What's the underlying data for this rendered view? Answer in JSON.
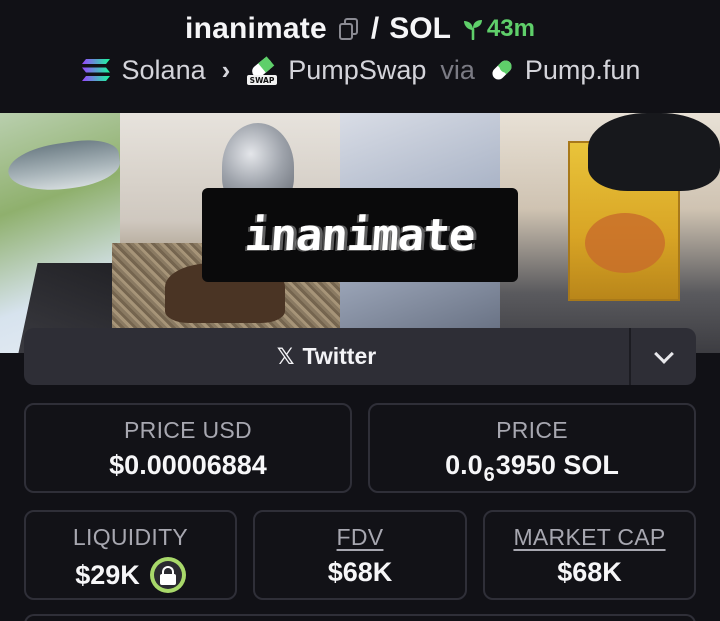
{
  "header": {
    "token_name": "inanimate",
    "separator": "/",
    "quote_symbol": "SOL",
    "age": "43m",
    "chain": "Solana",
    "dex": "PumpSwap",
    "via": "via",
    "launchpad": "Pump.fun",
    "icons": [
      "copy-icon",
      "sprout-icon",
      "solana-icon",
      "pumpswap-icon",
      "pill-icon"
    ],
    "age_color": "#5fcf6a"
  },
  "banner": {
    "logo_text": "inanimate"
  },
  "socials": {
    "twitter_label": "Twitter",
    "x_glyph": "𝕏"
  },
  "stats": {
    "price_usd": {
      "label": "PRICE USD",
      "value": "$0.00006884"
    },
    "price": {
      "label": "PRICE",
      "value_prefix": "0.0",
      "value_zeros": "6",
      "value_suffix": "3950 SOL"
    },
    "liquidity": {
      "label": "LIQUIDITY",
      "value": "$29K"
    },
    "fdv": {
      "label": "FDV",
      "value": "$68K"
    },
    "market_cap": {
      "label": "MARKET CAP",
      "value": "$68K"
    }
  },
  "colors": {
    "background": "#111116",
    "card_border": "#2f2f38",
    "lock_badge": "#a8d86a"
  }
}
